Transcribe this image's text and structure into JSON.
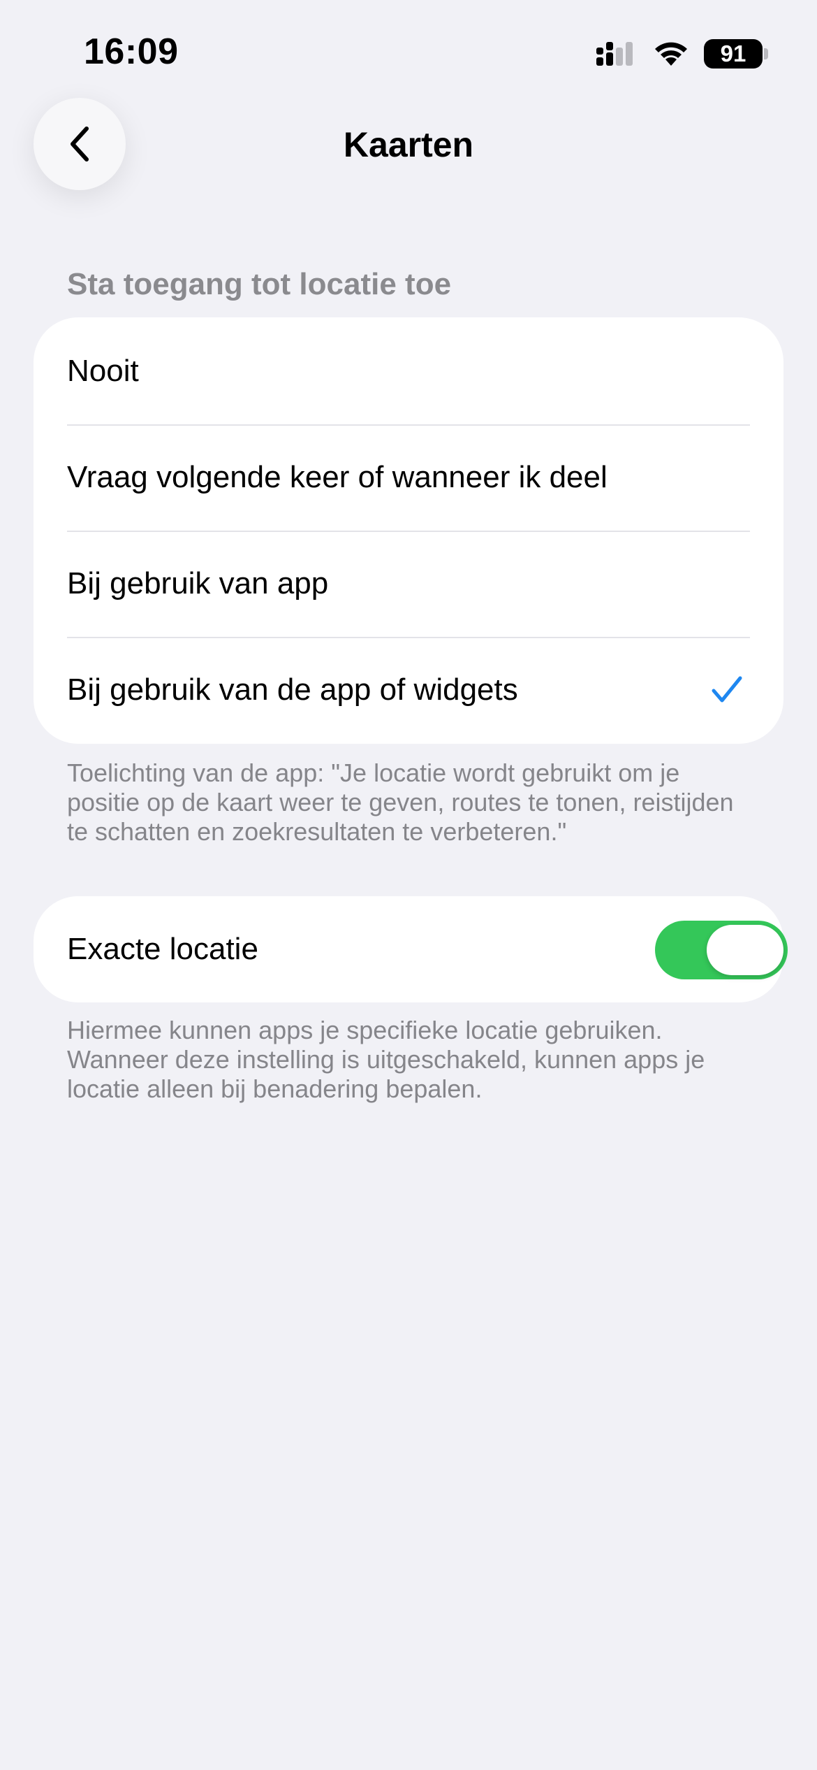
{
  "status_bar": {
    "time": "16:09",
    "battery_level": "91",
    "icons": [
      "signal-icon",
      "wifi-icon",
      "battery-icon"
    ]
  },
  "nav": {
    "back_icon": "chevron-left-icon",
    "title": "Kaarten"
  },
  "location_access": {
    "header": "Sta toegang tot locatie toe",
    "options": [
      {
        "label": "Nooit",
        "selected": false
      },
      {
        "label": "Vraag volgende keer of wanneer ik deel",
        "selected": false
      },
      {
        "label": "Bij gebruik van app",
        "selected": false
      },
      {
        "label": "Bij gebruik van de app of widgets",
        "selected": true
      }
    ],
    "explanation": "Toelichting van de app: \"Je locatie wordt gebruikt om je positie op de kaart weer te geven, routes te tonen, reistijden te schatten en zoekresultaten te verbeteren.\""
  },
  "precise_location": {
    "label": "Exacte locatie",
    "enabled": true,
    "description": "Hiermee kunnen apps je specifieke locatie gebruiken. Wanneer deze instelling is uitgeschakeld, kunnen apps je locatie alleen bij benadering bepalen."
  },
  "colors": {
    "background": "#F1F1F6",
    "card": "#FFFFFF",
    "accent_check": "#1E87F0",
    "toggle_on": "#34C759",
    "secondary_text": "#85858A"
  }
}
